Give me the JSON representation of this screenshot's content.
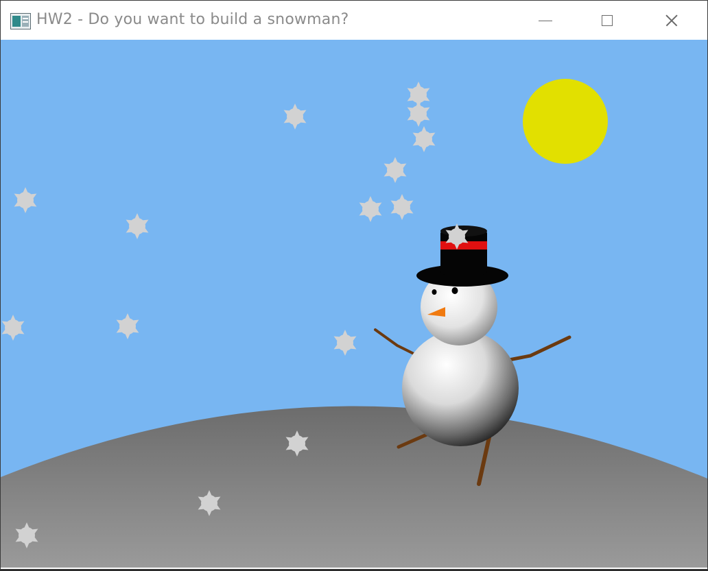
{
  "window": {
    "title": "HW2 - Do you want to build a snowman?",
    "app_icon": "window-app-icon",
    "controls": {
      "minimize_icon": "minimize-icon",
      "maximize_icon": "maximize-icon",
      "close_icon": "close-icon"
    }
  },
  "scene": {
    "colors": {
      "sky": "#78b6f2",
      "sun": "#e2e000",
      "ground": "#8a8a8a",
      "snowflake": "#d0d0d0",
      "hat": "#050505",
      "hat_band": "#e01010",
      "nose": "#f07a10",
      "arms": "#6b3a10"
    }
  }
}
